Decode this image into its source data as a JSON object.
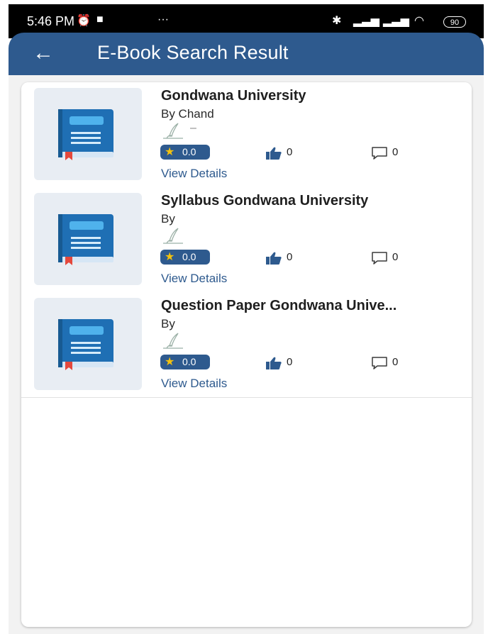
{
  "status_bar": {
    "time": "5:46 PM",
    "battery": "90"
  },
  "app_bar": {
    "title": "E-Book Search Result"
  },
  "results": [
    {
      "title": "Gondwana University",
      "author": "By Chand",
      "publisher": "–",
      "rating": "0.0",
      "likes": "0",
      "comments": "0",
      "details_label": "View Details"
    },
    {
      "title": "Syllabus Gondwana University",
      "author": "By",
      "publisher": "",
      "rating": "0.0",
      "likes": "0",
      "comments": "0",
      "details_label": "View Details"
    },
    {
      "title": "Question Paper Gondwana Unive...",
      "author": "By",
      "publisher": "",
      "rating": "0.0",
      "likes": "0",
      "comments": "0",
      "details_label": "View Details"
    }
  ],
  "colors": {
    "primary": "#2e5a8e",
    "star": "#f4c20d",
    "thumb_bg": "#e8edf3"
  },
  "icons": {
    "back": "arrow-left-icon",
    "book": "book-icon",
    "quill": "quill-icon",
    "star": "star-icon",
    "like": "thumbs-up-icon",
    "comment": "comment-icon"
  }
}
